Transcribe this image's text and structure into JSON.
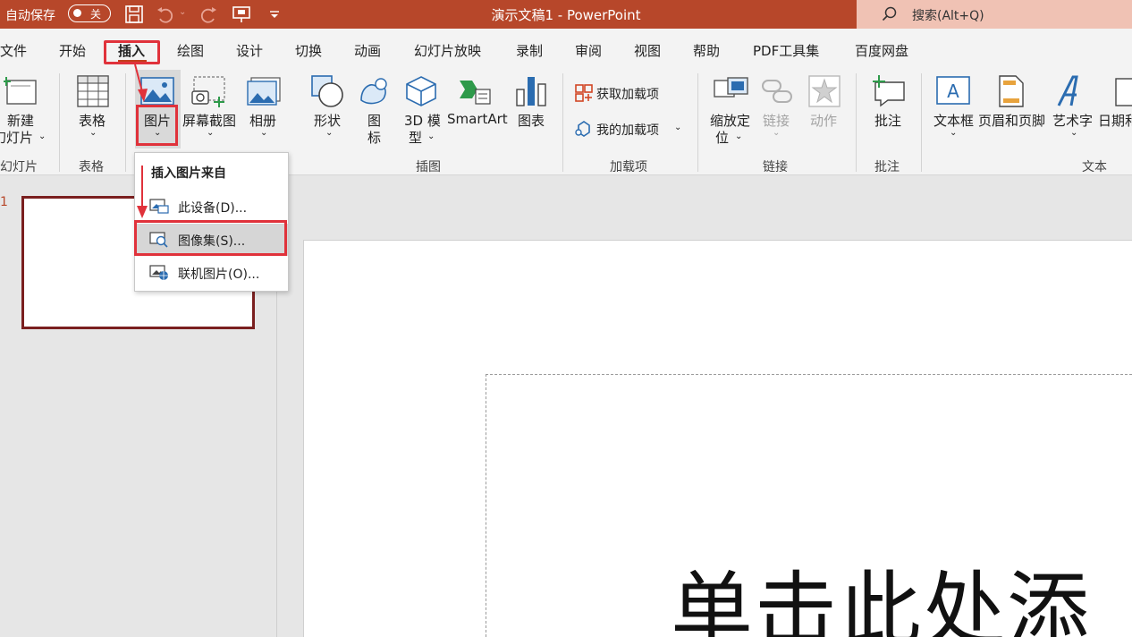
{
  "titlebar": {
    "autosave_label": "自动保存",
    "autosave_state": "关",
    "title": "演示文稿1  -  PowerPoint",
    "search_placeholder": "搜索(Alt+Q)"
  },
  "tabs": [
    "文件",
    "开始",
    "插入",
    "绘图",
    "设计",
    "切换",
    "动画",
    "幻灯片放映",
    "录制",
    "审阅",
    "视图",
    "帮助",
    "PDF工具集",
    "百度网盘"
  ],
  "active_tab": "插入",
  "ribbon": {
    "new_slide": {
      "line1": "新建",
      "line2": "幻灯片"
    },
    "table": "表格",
    "pictures": "图片",
    "screenshot": "屏幕截图",
    "album": "相册",
    "shapes": "形状",
    "icons": {
      "line1": "图",
      "line2": "标"
    },
    "model3d": {
      "line1": "3D 模",
      "line2": "型"
    },
    "smartart": "SmartArt",
    "chart": "图表",
    "get_addins": "获取加载项",
    "my_addins": "我的加载项",
    "zoom": {
      "line1": "缩放定",
      "line2": "位"
    },
    "link": "链接",
    "action": "动作",
    "comment": "批注",
    "textbox": "文本框",
    "header_footer": "页眉和页脚",
    "wordart": "艺术字",
    "datetime": "日期和",
    "groups": {
      "slides": "幻灯片",
      "tables": "表格",
      "illustrations": "插图",
      "addins": "加载项",
      "links": "链接",
      "comments": "批注",
      "text": "文本"
    }
  },
  "dropdown": {
    "header": "插入图片来自",
    "items": [
      "此设备(D)...",
      "图像集(S)...",
      "联机图片(O)..."
    ],
    "highlighted_index": 1
  },
  "thumbnail": {
    "number": "1"
  },
  "slide": {
    "title_placeholder": "单击此处添"
  },
  "colors": {
    "accent": "#b7472a",
    "highlight_box": "#e0323b"
  }
}
